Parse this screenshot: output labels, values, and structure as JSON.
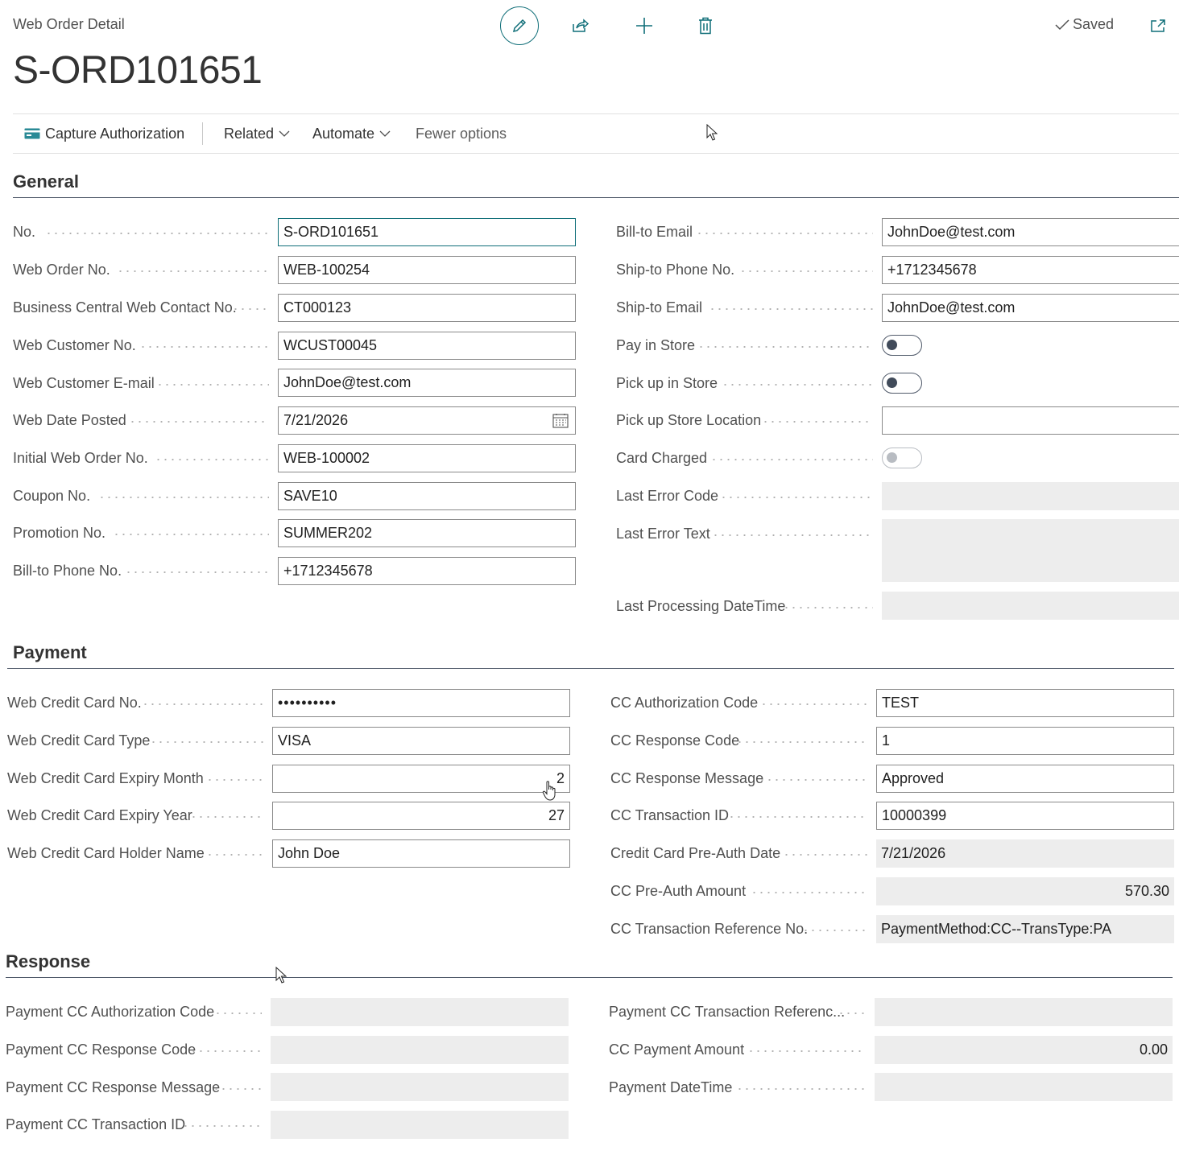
{
  "header": {
    "page_caption": "Web Order Detail",
    "record_title": "S-ORD101651",
    "saved_label": "Saved"
  },
  "icons": [
    "pencil-icon",
    "share-icon",
    "plus-icon",
    "trash-icon",
    "checkmark-icon",
    "popout-icon",
    "card-icon",
    "chevron-down-icon",
    "calendar-icon"
  ],
  "action_bar": {
    "capture": "Capture Authorization",
    "related": "Related",
    "automate": "Automate",
    "fewer": "Fewer options"
  },
  "general": {
    "title": "General",
    "left": [
      {
        "label": "No.",
        "value": "S-ORD101651"
      },
      {
        "label": "Web Order No.",
        "value": "WEB-100254"
      },
      {
        "label": "Business Central Web Contact No.",
        "value": "CT000123"
      },
      {
        "label": "Web Customer No.",
        "value": "WCUST00045"
      },
      {
        "label": "Web Customer E-mail",
        "value": "JohnDoe@test.com"
      },
      {
        "label": "Web Date Posted",
        "value": "7/21/2026"
      },
      {
        "label": "Initial Web Order No.",
        "value": "WEB-100002"
      },
      {
        "label": "Coupon No.",
        "value": "SAVE10"
      },
      {
        "label": "Promotion No.",
        "value": "SUMMER202"
      },
      {
        "label": "Bill-to Phone No.",
        "value": "+1712345678"
      }
    ],
    "right": [
      {
        "label": "Bill-to Email",
        "value": "JohnDoe@test.com"
      },
      {
        "label": "Ship-to Phone No.",
        "value": "+1712345678"
      },
      {
        "label": "Ship-to Email",
        "value": "JohnDoe@test.com"
      },
      {
        "label": "Pay in Store",
        "value": false
      },
      {
        "label": "Pick up in Store",
        "value": false
      },
      {
        "label": "Pick up Store Location",
        "value": ""
      },
      {
        "label": "Card Charged",
        "value": false
      },
      {
        "label": "Last Error Code",
        "value": ""
      },
      {
        "label": "Last Error Text",
        "value": ""
      },
      {
        "label": "Last Processing DateTime",
        "value": ""
      }
    ]
  },
  "payment": {
    "title": "Payment",
    "left": [
      {
        "label": "Web Credit Card No.",
        "value": "••••••••••"
      },
      {
        "label": "Web Credit Card Type",
        "value": "VISA"
      },
      {
        "label": "Web Credit Card Expiry Month",
        "value": "2"
      },
      {
        "label": "Web Credit Card Expiry Year",
        "value": "27"
      },
      {
        "label": "Web Credit Card Holder Name",
        "value": "John Doe"
      }
    ],
    "right": [
      {
        "label": "CC Authorization Code",
        "value": "TEST"
      },
      {
        "label": "CC Response Code",
        "value": "1"
      },
      {
        "label": "CC Response Message",
        "value": "Approved"
      },
      {
        "label": "CC Transaction ID",
        "value": "10000399"
      },
      {
        "label": "Credit Card Pre-Auth Date",
        "value": "7/21/2026"
      },
      {
        "label": "CC Pre-Auth Amount",
        "value": "570.30"
      },
      {
        "label": "CC Transaction Reference No.",
        "value": "PaymentMethod:CC--TransType:PA"
      }
    ]
  },
  "response": {
    "title": "Response",
    "left": [
      {
        "label": "Payment CC Authorization Code",
        "value": ""
      },
      {
        "label": "Payment CC Response Code",
        "value": ""
      },
      {
        "label": "Payment CC Response Message",
        "value": ""
      },
      {
        "label": "Payment CC Transaction ID",
        "value": ""
      }
    ],
    "right": [
      {
        "label": "Payment CC Transaction Referenc...",
        "value": ""
      },
      {
        "label": "CC Payment Amount",
        "value": "0.00"
      },
      {
        "label": "Payment DateTime",
        "value": ""
      }
    ]
  }
}
